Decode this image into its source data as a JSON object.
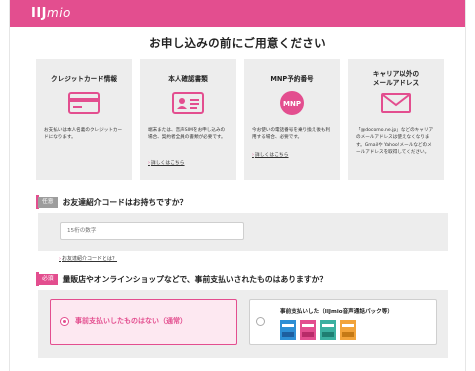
{
  "header": {
    "logo_main": "IIJ",
    "logo_sub": "mio",
    "brand_color": "#e34e8f"
  },
  "page_title": "お申し込みの前にご用意ください",
  "cards": [
    {
      "title_lines": [
        "クレジットカード情報"
      ],
      "icon": "credit-card-icon",
      "text": "お支払いは本人名義のクレジットカードになります。",
      "link": ""
    },
    {
      "title_lines": [
        "本人確認書類"
      ],
      "icon": "id-card-icon",
      "text": "端末または、音声SIMをお申し込みの場合、契約者全員の書類が必要です。",
      "link": "詳しくはこちら"
    },
    {
      "title_lines": [
        "MNP予約番号"
      ],
      "icon": "mnp-icon",
      "icon_text": "MNP",
      "text": "今お使いの電話番号を乗り換え後も利用する場合、必要です。",
      "link": "詳しくはこちら"
    },
    {
      "title_lines": [
        "キャリア以外の",
        "メールアドレス"
      ],
      "icon": "mail-icon",
      "text": "「@docomo.ne.jp」などのキャリアのメールアドレスは使えなくなります。Gmailや Yahoo!メールなどのメールアドレスを取得してください。",
      "link": ""
    }
  ],
  "referral": {
    "tag": "任意",
    "heading": "お友達紹介コードはお持ちですか？",
    "placeholder": "15桁の数字",
    "link": "お友達紹介コードとは？"
  },
  "prepay": {
    "tag": "必須",
    "heading": "量販店やオンラインショップなどで、事前支払いされたものはありますか？",
    "option_none": "事前支払いしたものはない（通常）",
    "option_some": "事前支払いした（IIJmio音声通話パック等）",
    "selected": "option_none"
  }
}
